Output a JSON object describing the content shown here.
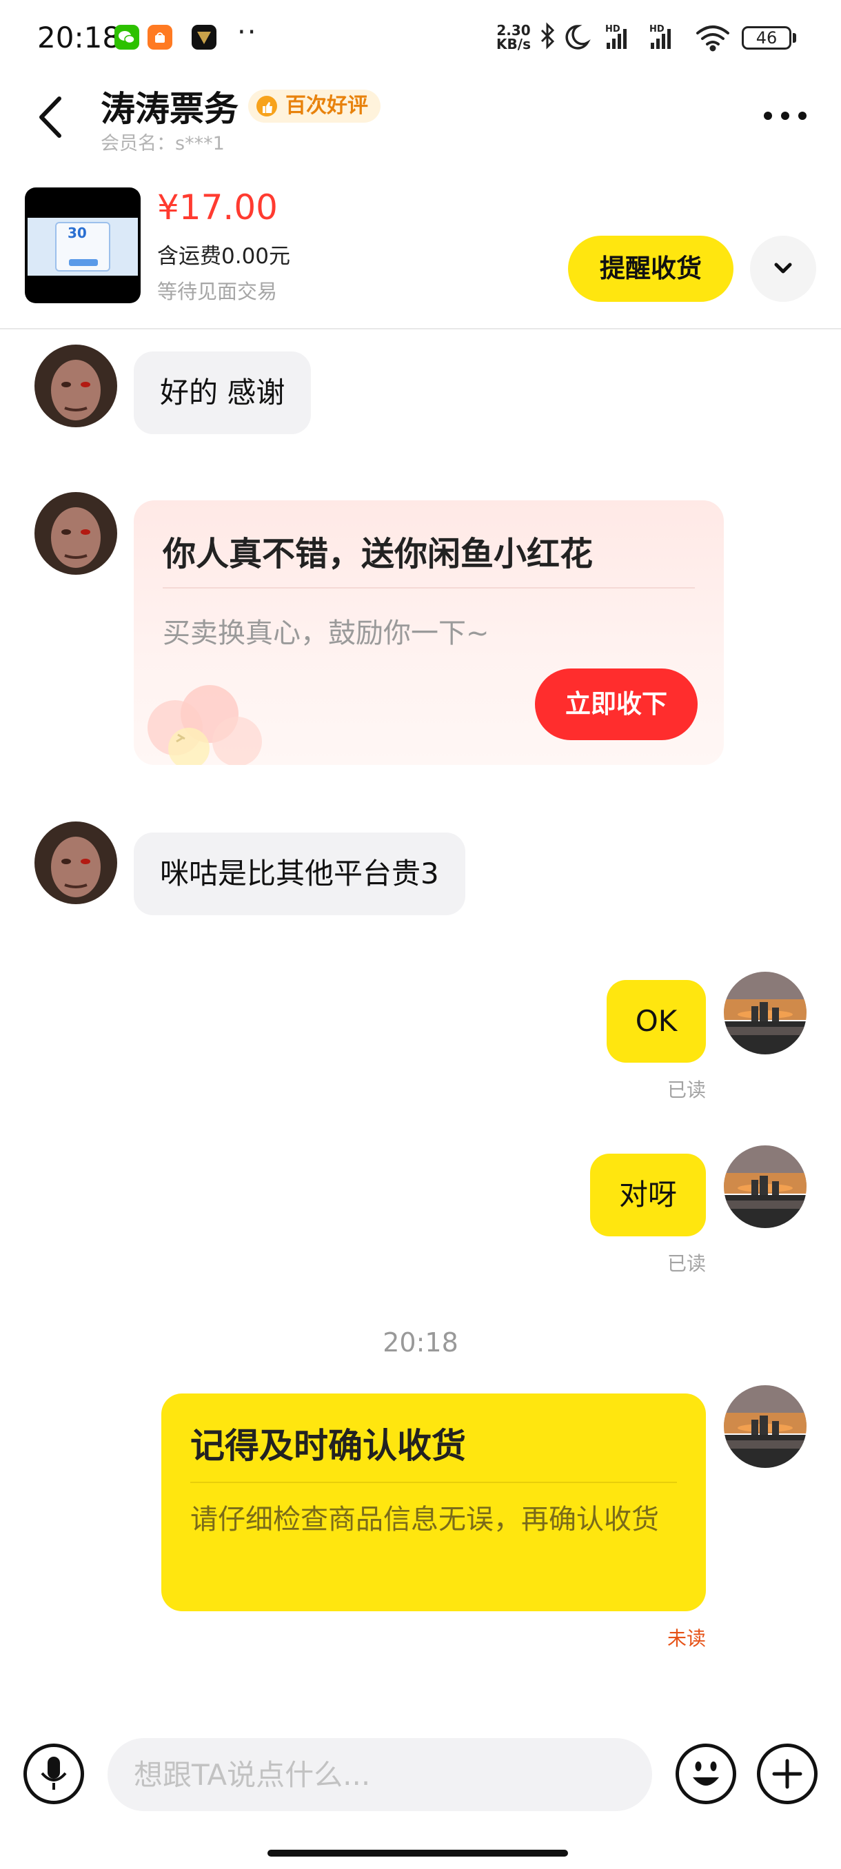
{
  "status_bar": {
    "time": "20:18",
    "network_speed_value": "2.30",
    "network_speed_unit": "KB/s",
    "hd1": "HD",
    "hd2": "HD",
    "battery": "46",
    "overflow_dots": "··"
  },
  "header": {
    "shop_name": "涛涛票务",
    "badge": "百次好评",
    "member_name": "会员名：s***1"
  },
  "product": {
    "thumb_text": "30",
    "price": "¥17.00",
    "shipping": "含运费0.00元",
    "deal_type": "等待见面交易",
    "remind_button": "提醒收货"
  },
  "messages": {
    "m1": "好的 感谢",
    "card_title": "你人真不错，送你闲鱼小红花",
    "card_subtitle": "买卖换真心，鼓励你一下~",
    "card_button": "立即收下",
    "m3": "咪咕是比其他平台贵3",
    "m4": "OK",
    "m4_status": "已读",
    "m5": "对呀",
    "m5_status": "已读",
    "timestamp": "20:18",
    "reminder_title": "记得及时确认收货",
    "reminder_body": "请仔细检查商品信息无误，再确认收货",
    "reminder_status": "未读"
  },
  "input": {
    "placeholder": "想跟TA说点什么..."
  },
  "colors": {
    "accent_yellow": "#ffe60f",
    "price_red": "#ff3b30",
    "button_red": "#ff2d2d",
    "unread_orange": "#e65217",
    "badge_orange": "#e8820c"
  }
}
